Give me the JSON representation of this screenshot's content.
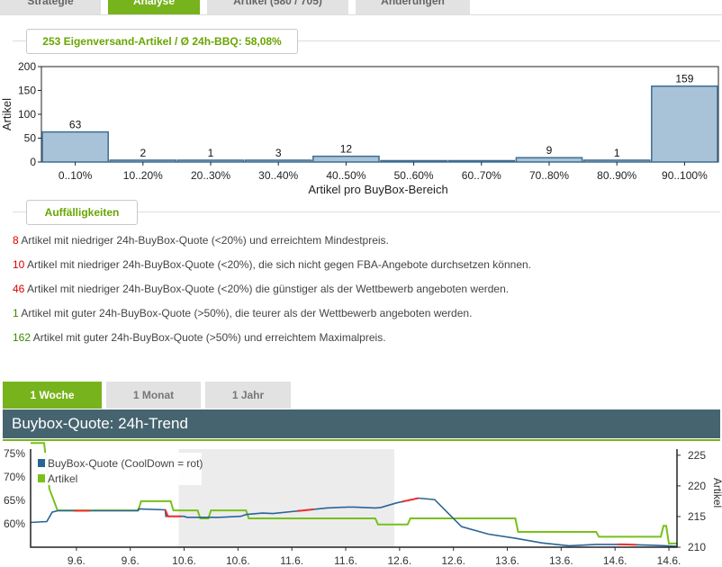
{
  "top_tabs": [
    {
      "label": "Strategie",
      "active": false
    },
    {
      "label": "Analyse",
      "active": true
    },
    {
      "label": "Artikel (580 / 705)",
      "active": false
    },
    {
      "label": "Änderungen",
      "active": false
    }
  ],
  "summary_label": "253 Eigenversand-Artikel / Ø 24h-BBQ: 58,08%",
  "findings_label": "Auffälligkeiten",
  "findings": [
    {
      "count": "8",
      "color": "red",
      "text": " Artikel mit niedriger 24h-BuyBox-Quote (<20%) und erreichtem Mindestpreis."
    },
    {
      "count": "10",
      "color": "red",
      "text": " Artikel mit niedriger 24h-BuyBox-Quote (<20%), die sich nicht gegen FBA-Angebote durchsetzen können."
    },
    {
      "count": "46",
      "color": "red",
      "text": " Artikel mit niedriger 24h-BuyBox-Quote (<20%) die günstiger als der Wettbewerb angeboten werden."
    },
    {
      "count": "1",
      "color": "green",
      "text": " Artikel mit guter 24h-BuyBox-Quote (>50%), die teurer als der Wettbewerb angeboten werden."
    },
    {
      "count": "162",
      "color": "green",
      "text": " Artikel mit guter 24h-BuyBox-Quote (>50%) und erreichtem Maximalpreis."
    }
  ],
  "period_tabs": [
    {
      "label": "1 Woche",
      "active": true
    },
    {
      "label": "1 Monat",
      "active": false
    },
    {
      "label": "1 Jahr",
      "active": false
    }
  ],
  "trend_title": "Buybox-Quote: 24h-Trend",
  "colors": {
    "accent": "#77b31c",
    "bar_fill": "#a8c3d8",
    "bar_stroke": "#3f6d92",
    "header": "#466470",
    "line_blue": "#2a6496",
    "line_green": "#77c11a",
    "cooldown": "#e83030"
  },
  "chart_data": [
    {
      "type": "bar",
      "categories": [
        "0..10%",
        "10..20%",
        "20..30%",
        "30..40%",
        "40..50%",
        "50..60%",
        "60..70%",
        "70..80%",
        "80..90%",
        "90..100%"
      ],
      "values": [
        63,
        2,
        1,
        3,
        12,
        0,
        0,
        9,
        1,
        159
      ],
      "data_labels": [
        "63",
        "2",
        "1",
        "3",
        "12",
        "",
        "",
        "9",
        "1",
        "159"
      ],
      "ylabel": "Artikel",
      "xlabel": "Artikel pro BuyBox-Bereich",
      "ylim": [
        0,
        200
      ],
      "yticks": [
        "0",
        "50",
        "100",
        "150",
        "200"
      ],
      "grid": false
    },
    {
      "type": "line",
      "x_ticks": [
        "9.6.",
        "9.6.",
        "10.6.",
        "10.6.",
        "11.6.",
        "11.6.",
        "12.6.",
        "12.6.",
        "13.6.",
        "13.6.",
        "14.6.",
        "14.6."
      ],
      "y_left_ticks": [
        "60%",
        "65%",
        "70%",
        "75%"
      ],
      "y_right_ticks": [
        "210",
        "215",
        "220",
        "225"
      ],
      "y_right_label": "Artikel",
      "y_left_range": [
        55,
        76
      ],
      "y_right_range": [
        210,
        226
      ],
      "legend": "top-left",
      "series": [
        {
          "name": "BuyBox-Quote (CoolDown = rot)",
          "axis": "left",
          "t": [
            0,
            0.3,
            0.4,
            0.5,
            0.55,
            1.0,
            1.5,
            1.99,
            2.0,
            2.5,
            2.51,
            2.85,
            2.9,
            3.5,
            3.9,
            4.0,
            4.3,
            4.5,
            5.0,
            5.5,
            5.9,
            6.0,
            6.2,
            6.4,
            6.5,
            6.8,
            7.0,
            7.2,
            7.5,
            8.0,
            8.5,
            9.0,
            9.5,
            10.0,
            10.5,
            11.0,
            11.3,
            11.6,
            11.8,
            12.0
          ],
          "v": [
            60.3,
            60.5,
            62.5,
            62.8,
            62.8,
            62.8,
            62.8,
            62.8,
            63.2,
            63.0,
            61.6,
            61.6,
            61.4,
            61.4,
            61.6,
            62.0,
            62.3,
            62.2,
            62.8,
            63.4,
            63.6,
            63.6,
            63.5,
            63.4,
            63.5,
            64.5,
            65.0,
            65.5,
            65.2,
            59.4,
            57.8,
            56.9,
            55.9,
            55.3,
            55.6,
            55.6,
            55.5,
            55.4,
            55.3,
            55.2
          ],
          "cooldown": [
            [
              0.8,
              1.1
            ],
            [
              2.5,
              2.8
            ],
            [
              4.95,
              5.25
            ],
            [
              6.9,
              7.2
            ],
            [
              10.9,
              11.25
            ]
          ]
        },
        {
          "name": "Artikel",
          "axis": "right",
          "t": [
            0,
            0.25,
            0.35,
            0.5,
            2.0,
            2.05,
            2.6,
            2.65,
            3.1,
            3.15,
            3.3,
            3.35,
            4.0,
            4.05,
            6.4,
            6.45,
            7.0,
            7.05,
            9.0,
            9.05,
            10.5,
            10.55,
            11.7,
            11.75,
            11.8,
            11.85,
            12.0
          ],
          "v": [
            227,
            227,
            219.5,
            216,
            216,
            217.5,
            217.5,
            216,
            216,
            214.7,
            214.7,
            216,
            216,
            214.7,
            214.7,
            213.7,
            213.7,
            214.7,
            214.7,
            212.5,
            212.5,
            211.7,
            211.7,
            213.5,
            213.5,
            210.6,
            210.6
          ]
        }
      ]
    }
  ]
}
